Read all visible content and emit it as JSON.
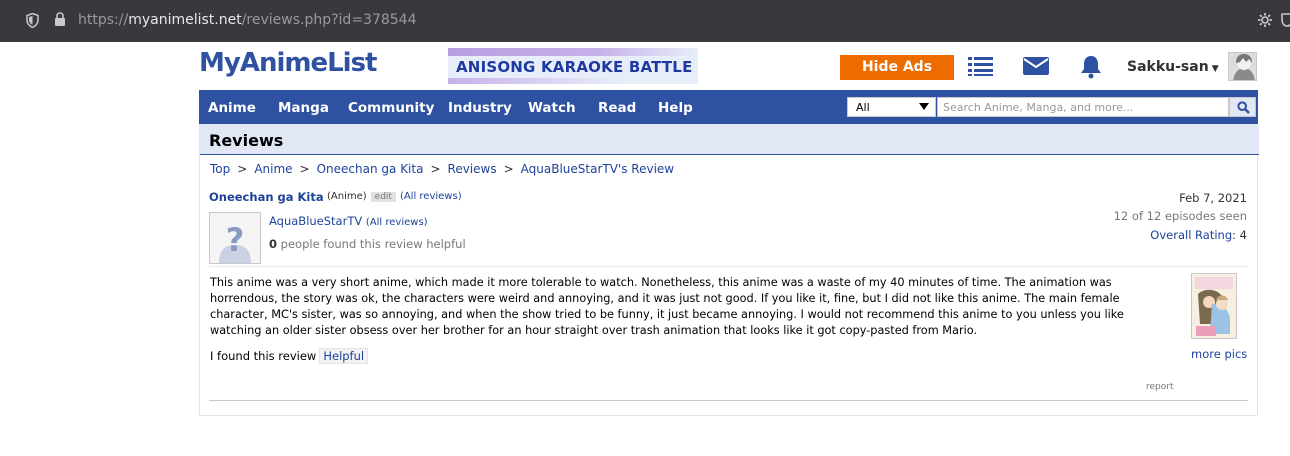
{
  "browser": {
    "url_scheme": "https://",
    "url_host": "myanimelist.net",
    "url_path": "/reviews.php?id=378544"
  },
  "header": {
    "logo": "MyAnimeList",
    "banner_text": "ANISONG KARAOKE BATTLE",
    "hide_ads": "Hide Ads",
    "username": "Sakku-san",
    "icons": [
      "list-icon",
      "mail-icon",
      "bell-icon"
    ]
  },
  "nav": {
    "items": [
      "Anime",
      "Manga",
      "Community",
      "Industry",
      "Watch",
      "Read",
      "Help"
    ],
    "search_category": "All",
    "search_placeholder": "Search Anime, Manga, and more..."
  },
  "page": {
    "title": "Reviews",
    "breadcrumbs": [
      "Top",
      "Anime",
      "Oneechan ga Kita",
      "Reviews",
      "AquaBlueStarTV's Review"
    ],
    "breadcrumb_sep": ">"
  },
  "review": {
    "anime_title": "Oneechan ga Kita",
    "type_label": "(Anime)",
    "edit_label": "edit",
    "all_reviews_label": "(All reviews)",
    "reviewer": "AquaBlueStarTV",
    "reviewer_all_reviews": "(All reviews)",
    "helpful_count": "0",
    "helpful_text": "people found this review helpful",
    "date": "Feb 7, 2021",
    "episodes_seen": "12 of 12 episodes seen",
    "overall_label": "Overall Rating",
    "overall_value": "4",
    "body": "This anime was a very short anime, which made it more tolerable to watch. Nonetheless, this anime was a waste of my 40 minutes of time. The animation was horrendous, the story was ok, the characters were weird and annoying, and it was just not good. If you like it, fine, but I did not like this anime. The main female character, MC's sister, was so annoying, and when the show tried to be funny, it just became annoying. I would not recommend this anime to you unless you like watching an older sister obsess over her brother for an hour straight over trash animation that looks like it got copy-pasted from Mario.",
    "found_label": "I found this review",
    "helpful_button": "Helpful",
    "more_pics": "more pics",
    "report": "report"
  },
  "colors": {
    "brand_blue": "#2e51a2",
    "link_blue": "#1c439b",
    "hide_ads_orange": "#ee6b00",
    "header_bg": "#e1e7f5"
  }
}
